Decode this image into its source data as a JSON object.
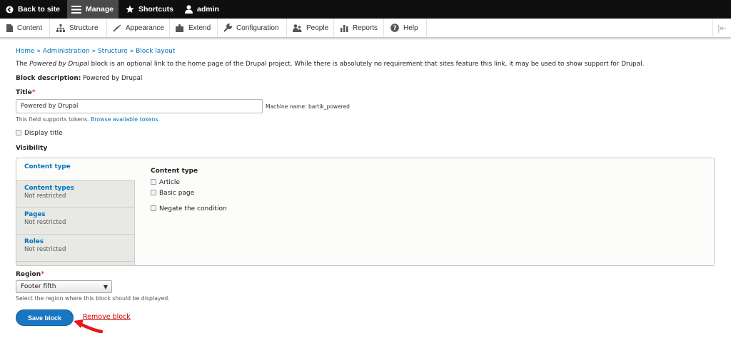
{
  "toolbar": {
    "back": "Back to site",
    "manage": "Manage",
    "shortcuts": "Shortcuts",
    "user": "admin"
  },
  "tray": {
    "items": [
      "Content",
      "Structure",
      "Appearance",
      "Extend",
      "Configuration",
      "People",
      "Reports",
      "Help"
    ],
    "collapse_icon": "|⇤"
  },
  "breadcrumb": {
    "items": [
      "Home",
      "Administration",
      "Structure",
      "Block layout"
    ],
    "separator": "»"
  },
  "intro": {
    "pre": "The ",
    "em": "Powered by Drupal",
    "post": " block is an optional link to the home page of the Drupal project. While there is absolutely no requirement that sites feature this link, it may be used to show support for Drupal."
  },
  "block_description": {
    "label": "Block description:",
    "value": "Powered by Drupal"
  },
  "title_field": {
    "label": "Title",
    "required_mark": "*",
    "value": "Powered by Drupal",
    "machine_name": "Machine name: bartik_powered",
    "help": "This field supports tokens.",
    "tokens_link": "Browse available tokens."
  },
  "display_title": {
    "label": "Display title",
    "checked": false
  },
  "visibility": {
    "heading": "Visibility",
    "tabs": [
      {
        "title": "Content type",
        "summary": ""
      },
      {
        "title": "Content types",
        "summary": "Not restricted"
      },
      {
        "title": "Pages",
        "summary": "Not restricted"
      },
      {
        "title": "Roles",
        "summary": "Not restricted"
      }
    ],
    "pane": {
      "heading": "Content type",
      "options": [
        "Article",
        "Basic page"
      ],
      "negate": "Negate the condition"
    }
  },
  "region": {
    "label": "Region",
    "required_mark": "*",
    "selected": "Footer fifth",
    "help": "Select the region where this block should be displayed."
  },
  "actions": {
    "save": "Save block",
    "remove": "Remove block"
  },
  "colors": {
    "link": "#0074bd",
    "primary_button": "#1a76c2",
    "danger": "#cc0000",
    "toolbar": "#0f0f0f",
    "annotation_arrow": "#e8161b"
  }
}
